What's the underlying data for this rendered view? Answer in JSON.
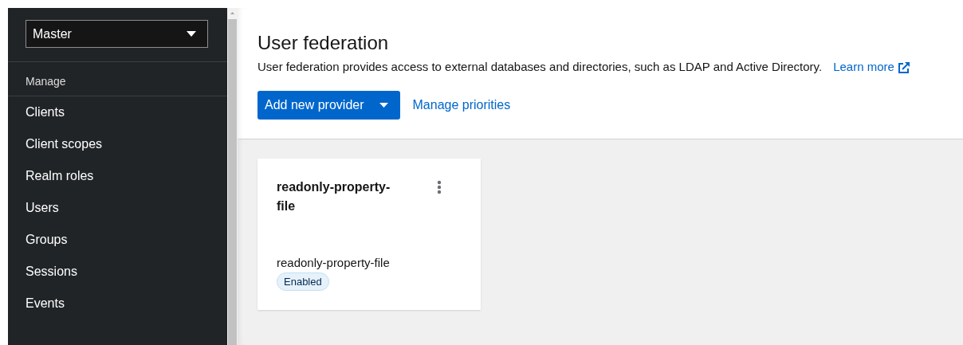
{
  "sidebar": {
    "realm_select": {
      "value": "Master"
    },
    "section_title": "Manage",
    "items": [
      {
        "label": "Clients",
        "selected": false
      },
      {
        "label": "Client scopes",
        "selected": false
      },
      {
        "label": "Realm roles",
        "selected": false
      },
      {
        "label": "Users",
        "selected": false
      },
      {
        "label": "Groups",
        "selected": false
      },
      {
        "label": "Sessions",
        "selected": false
      },
      {
        "label": "Events",
        "selected": false
      }
    ]
  },
  "header": {
    "title": "User federation",
    "description": "User federation provides access to external databases and directories, such as LDAP and Active Directory.",
    "learn_more": "Learn more",
    "add_button": "Add new provider",
    "manage_link": "Manage priorities"
  },
  "providers": [
    {
      "title": "readonly-property-file",
      "name": "readonly-property-file",
      "status": "Enabled"
    }
  ]
}
